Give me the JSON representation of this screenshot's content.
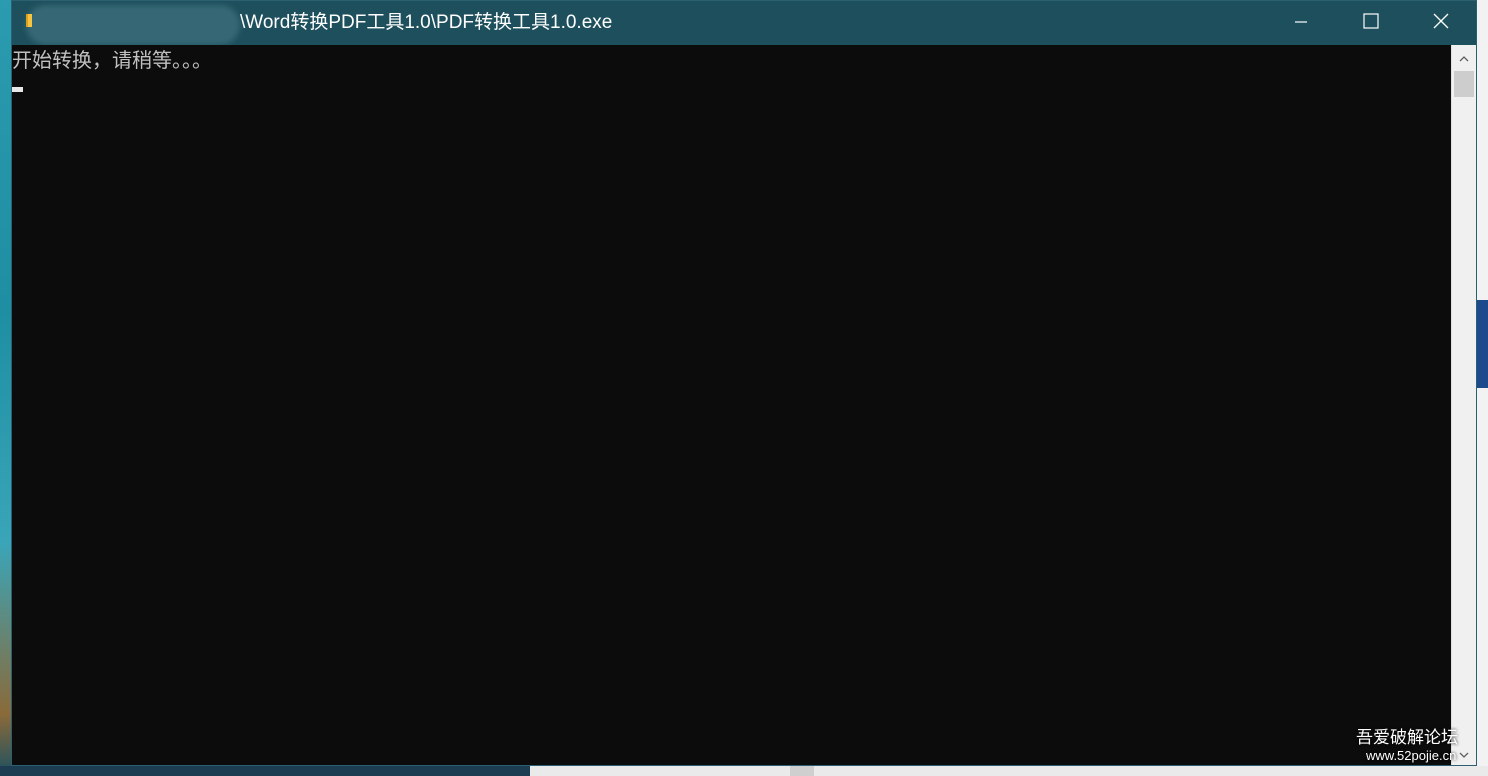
{
  "window": {
    "title_path": "\\Word转换PDF工具1.0\\PDF转换工具1.0.exe"
  },
  "console": {
    "lines": [
      "开始转换，请稍等。。。"
    ]
  },
  "watermark": {
    "line1": "吾爱破解论坛",
    "line2": "www.52pojie.cn"
  },
  "icons": {
    "app_icon": "folder-exe-icon",
    "minimize": "minimize-icon",
    "maximize": "maximize-icon",
    "close": "close-icon",
    "scroll_up": "chevron-up-icon",
    "scroll_down": "chevron-down-icon"
  },
  "colors": {
    "titlebar": "#1d4f5c",
    "console_bg": "#0c0c0c",
    "console_text": "#c0c0c0"
  }
}
